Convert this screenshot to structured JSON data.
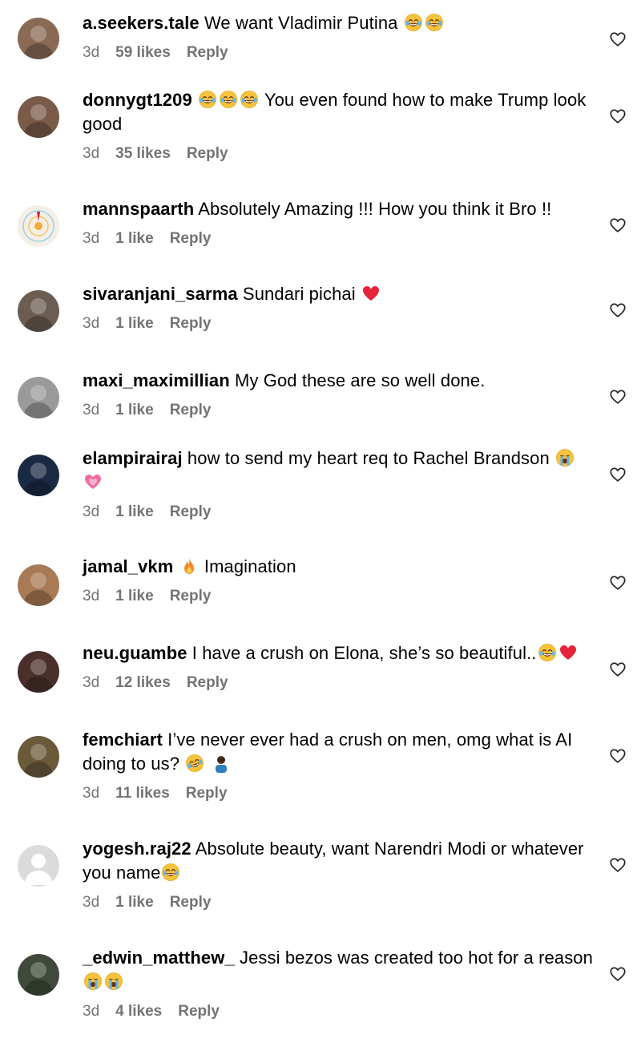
{
  "comments": [
    {
      "username": "a.seekers.tale",
      "text_parts": [
        " We want Vladimir Putina ",
        "😂",
        "😂"
      ],
      "time": "3d",
      "likes": "59 likes",
      "reply": "Reply",
      "avatar_color": "#8a6a55"
    },
    {
      "username": "donnygt1209",
      "text_parts": [
        " ",
        "😂",
        "😂",
        "😂",
        " You even found how to make Trump look good"
      ],
      "time": "3d",
      "likes": "35 likes",
      "reply": "Reply",
      "avatar_color": "#7a5a48"
    },
    {
      "username": "mannspaarth",
      "text_parts": [
        " Absolutely Amazing !!! How you think it Bro !!"
      ],
      "time": "3d",
      "likes": "1 like",
      "reply": "Reply",
      "avatar_color": "#e8e2d4"
    },
    {
      "username": "sivaranjani_sarma",
      "text_parts": [
        " Sundari pichai ",
        "❤️"
      ],
      "time": "3d",
      "likes": "1 like",
      "reply": "Reply",
      "avatar_color": "#6b5d52"
    },
    {
      "username": "maxi_maximillian",
      "text_parts": [
        " My God these are so well done."
      ],
      "time": "3d",
      "likes": "1 like",
      "reply": "Reply",
      "avatar_color": "#9a9a9a"
    },
    {
      "username": "elampirairaj",
      "text_parts": [
        " how to send my heart req to Rachel Brandson ",
        "😭",
        " ",
        "💗"
      ],
      "time": "3d",
      "likes": "1 like",
      "reply": "Reply",
      "avatar_color": "#1b2a44"
    },
    {
      "username": "jamal_vkm",
      "text_parts": [
        " ",
        "🔥",
        " Imagination"
      ],
      "time": "3d",
      "likes": "1 like",
      "reply": "Reply",
      "avatar_color": "#a87a55"
    },
    {
      "username": "neu.guambe",
      "text_parts": [
        " I have a crush on Elona, she’s so beautiful..",
        "😂",
        "❤️"
      ],
      "time": "3d",
      "likes": "12 likes",
      "reply": "Reply",
      "avatar_color": "#4a2f2a"
    },
    {
      "username": "femchiart",
      "text_parts": [
        " I’ve never ever had a crush on men, omg what is AI doing to us? ",
        "🤣",
        " ",
        "🤦🏿‍♂️"
      ],
      "time": "3d",
      "likes": "11 likes",
      "reply": "Reply",
      "avatar_color": "#6a5a3a"
    },
    {
      "username": "yogesh.raj22",
      "text_parts": [
        " Absolute beauty, want Narendri Modi or whatever you name",
        "😂"
      ],
      "time": "3d",
      "likes": "1 like",
      "reply": "Reply",
      "avatar_color": "#dbdbdb"
    },
    {
      "username": "_edwin_matthew_",
      "text_parts": [
        " Jessi bezos was created too hot for a reason ",
        "😭",
        "😭"
      ],
      "time": "3d",
      "likes": "4 likes",
      "reply": "Reply",
      "avatar_color": "#3f4a3a"
    }
  ]
}
